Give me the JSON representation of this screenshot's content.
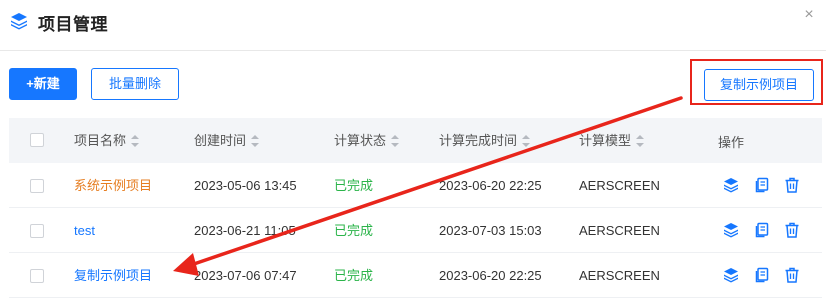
{
  "dialog": {
    "title": "项目管理",
    "close_symbol": "×"
  },
  "toolbar": {
    "new_label": "+新建",
    "batch_delete_label": "批量删除",
    "copy_example_label": "复制示例项目"
  },
  "table": {
    "columns": [
      "项目名称",
      "创建时间",
      "计算状态",
      "计算完成时间",
      "计算模型",
      "操作"
    ],
    "rows": [
      {
        "name": "系统示例项目",
        "created": "2023-05-06 13:45",
        "status": "已完成",
        "finished": "2023-06-20 22:25",
        "model": "AERSCREEN"
      },
      {
        "name": "test",
        "created": "2023-06-21 11:05",
        "status": "已完成",
        "finished": "2023-07-03 15:03",
        "model": "AERSCREEN"
      },
      {
        "name": "复制示例项目",
        "created": "2023-07-06 07:47",
        "status": "已完成",
        "finished": "2023-06-20 22:25",
        "model": "AERSCREEN"
      }
    ]
  },
  "icons": {
    "dialog_logo": "layers-icon",
    "row_actions": [
      "layers-icon",
      "copy-icon",
      "trash-icon"
    ]
  },
  "colors": {
    "primary": "#1677ff",
    "annotation": "#e8251b",
    "status_done": "#2bb44a",
    "system_project": "#e67e22"
  }
}
